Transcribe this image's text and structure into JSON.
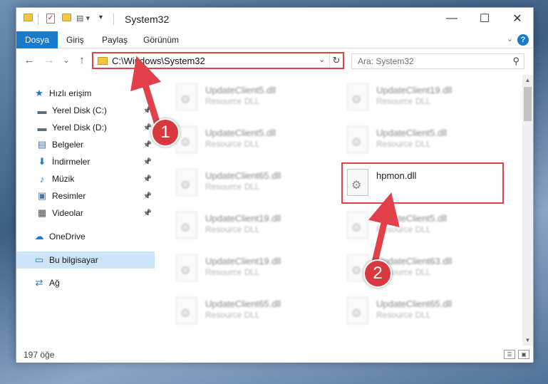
{
  "window": {
    "title": "System32",
    "controls": {
      "minimize": "—",
      "maximize": "☐",
      "close": "✕"
    }
  },
  "ribbon": {
    "tabs": [
      "Dosya",
      "Giriş",
      "Paylaş",
      "Görünüm"
    ],
    "active_tab": "Dosya",
    "help": "?"
  },
  "navigation": {
    "back": "←",
    "forward": "→",
    "recent": "⌄",
    "up": "↑",
    "address": "C:\\Windows\\System32",
    "refresh": "↻",
    "search_placeholder": "Ara: System32"
  },
  "sidebar": {
    "items": [
      {
        "label": "Hızlı erişim",
        "icon": "star-icon",
        "glyph": "★",
        "color": "#1979ca",
        "pinned": false
      },
      {
        "label": "Yerel Disk (C:)",
        "icon": "drive-icon",
        "glyph": "▬",
        "color": "#5a6c80",
        "pinned": true
      },
      {
        "label": "Yerel Disk (D:)",
        "icon": "drive-icon",
        "glyph": "▬",
        "color": "#5a6c80",
        "pinned": true
      },
      {
        "label": "Belgeler",
        "icon": "documents-icon",
        "glyph": "▤",
        "color": "#4a76a8",
        "pinned": true
      },
      {
        "label": "İndirmeler",
        "icon": "download-icon",
        "glyph": "⬇",
        "color": "#1979ca",
        "pinned": true
      },
      {
        "label": "Müzik",
        "icon": "music-icon",
        "glyph": "♪",
        "color": "#1979ca",
        "pinned": true
      },
      {
        "label": "Resimler",
        "icon": "pictures-icon",
        "glyph": "▣",
        "color": "#4a76a8",
        "pinned": true
      },
      {
        "label": "Videolar",
        "icon": "videos-icon",
        "glyph": "▦",
        "color": "#4a4a4a",
        "pinned": true
      },
      {
        "label": "OneDrive",
        "icon": "cloud-icon",
        "glyph": "☁",
        "color": "#1979ca",
        "pinned": false
      },
      {
        "label": "Bu bilgisayar",
        "icon": "computer-icon",
        "glyph": "▭",
        "color": "#1979ca",
        "pinned": false,
        "selected": true
      },
      {
        "label": "Ağ",
        "icon": "network-icon",
        "glyph": "⇄",
        "color": "#1979ca",
        "pinned": false
      }
    ]
  },
  "files": [
    {
      "name": "UpdateClient5.dll",
      "type": "Resource DLL"
    },
    {
      "name": "UpdateClient19.dll",
      "type": "Resource DLL"
    },
    {
      "name": "UpdateClient5.dll",
      "type": "Resource DLL"
    },
    {
      "name": "UpdateClient5.dll",
      "type": "Resource DLL"
    },
    {
      "name": "UpdateClient65.dll",
      "type": "Resource DLL"
    },
    {
      "name": "hpmon.dll",
      "type": "",
      "focus": true
    },
    {
      "name": "UpdateClient19.dll",
      "type": "Resource DLL"
    },
    {
      "name": "UpdateClient5.dll",
      "type": "Resource DLL"
    },
    {
      "name": "UpdateClient19.dll",
      "type": "Resource DLL"
    },
    {
      "name": "UpdateClient63.dll",
      "type": "Resource DLL"
    },
    {
      "name": "UpdateClient65.dll",
      "type": "Resource DLL"
    },
    {
      "name": "UpdateClient65.dll",
      "type": "Resource DLL"
    }
  ],
  "status": {
    "item_count": "197 öğe"
  },
  "annotations": {
    "step1": "1",
    "step2": "2",
    "color": "#e2414a"
  }
}
